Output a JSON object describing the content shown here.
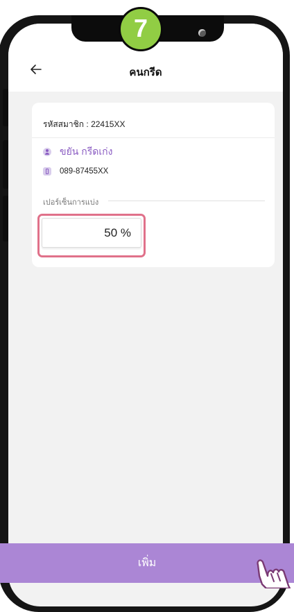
{
  "step": {
    "number": "7"
  },
  "header": {
    "title": "คนกรีด",
    "back_icon": "arrow-left-icon"
  },
  "member": {
    "id_label": "รหัสสมาชิก :",
    "id_value": "22415XX",
    "name": "ขยัน กรีดเก่ง",
    "phone": "089-87455XX"
  },
  "share": {
    "label": "เปอร์เซ็นการแบ่ง",
    "value": "50 %"
  },
  "add_button": {
    "label": "เพิ่ม"
  },
  "colors": {
    "accent_purple": "#8a5cc2",
    "button_purple": "#ab86d5",
    "highlight_pink": "#e0718a",
    "badge_green": "#91cd44"
  }
}
